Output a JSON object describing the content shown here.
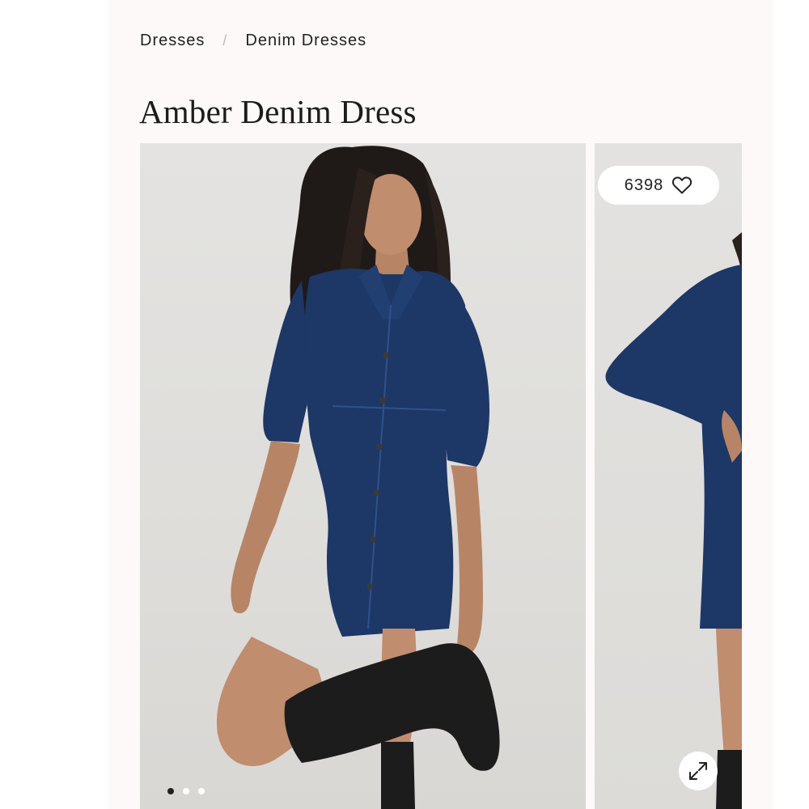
{
  "breadcrumb": {
    "items": [
      {
        "label": "Dresses"
      },
      {
        "label": "Denim Dresses"
      }
    ],
    "separator": "/"
  },
  "product": {
    "title": "Amber Denim Dress"
  },
  "gallery": {
    "favorites": {
      "count": "6398",
      "icon": "heart-icon"
    },
    "expand_icon": "expand-icon",
    "pagination": {
      "total": 3,
      "active_index": 0
    }
  },
  "colors": {
    "page_background": "#fcf9f8",
    "denim": "#1d3766",
    "boot": "#1c1c1c",
    "text": "#222222"
  }
}
